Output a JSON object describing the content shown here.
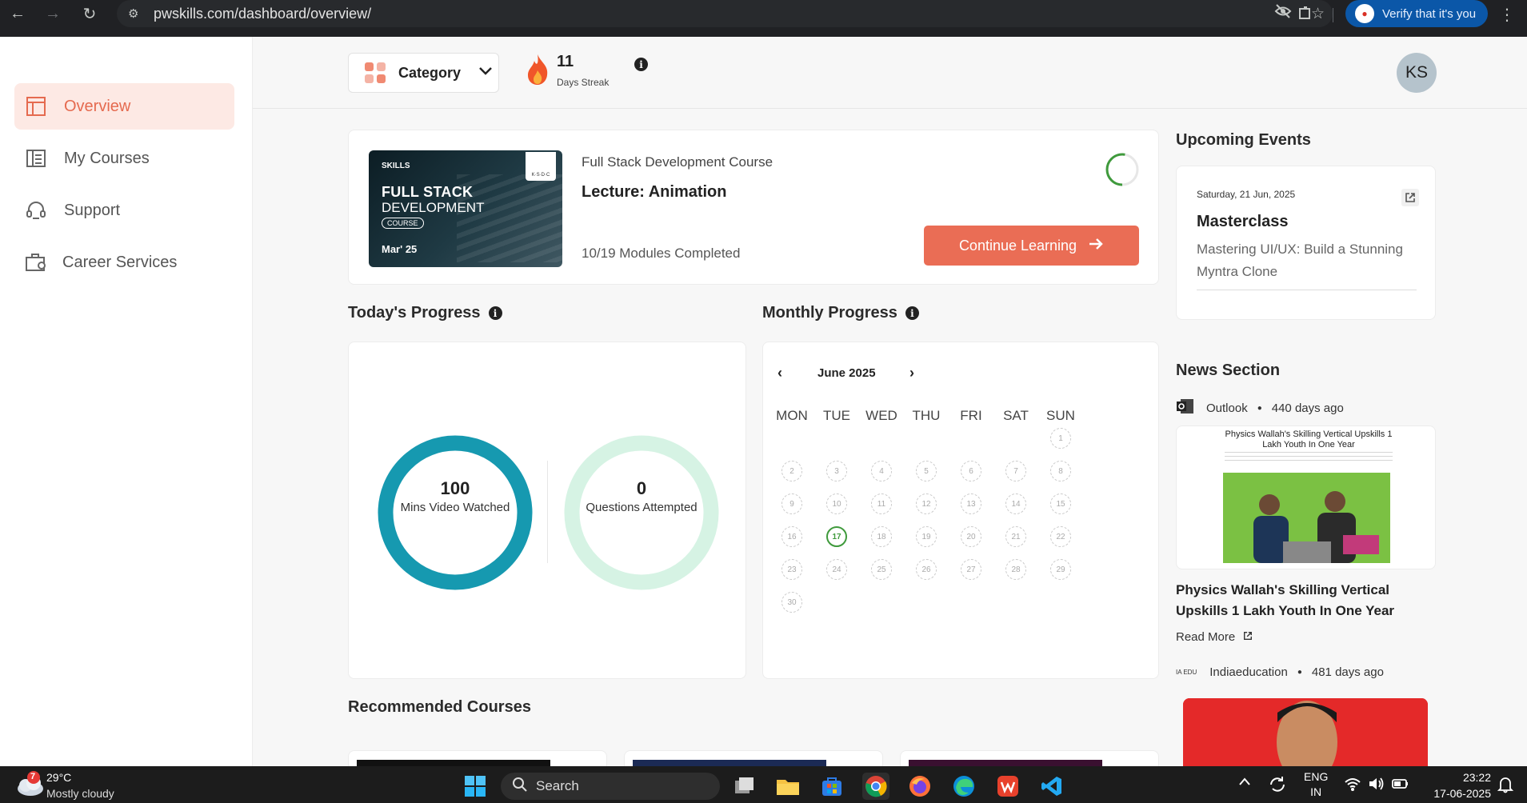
{
  "browser": {
    "url": "pwskills.com/dashboard/overview/",
    "verify_label": "Verify that it's you"
  },
  "sidebar": {
    "items": [
      {
        "label": "Overview",
        "icon": "layout-icon",
        "active": true
      },
      {
        "label": "My Courses",
        "icon": "courses-icon",
        "active": false
      },
      {
        "label": "Support",
        "icon": "headset-icon",
        "active": false
      },
      {
        "label": "Career Services",
        "icon": "briefcase-icon",
        "active": false
      }
    ]
  },
  "topbar": {
    "category_label": "Category",
    "streak_count": "11",
    "streak_label": "Days Streak",
    "avatar_initials": "KS"
  },
  "course": {
    "thumb_brand": "SKILLS",
    "thumb_line1": "FULL STACK",
    "thumb_line2": "DEVELOPMENT",
    "thumb_tag": "COURSE",
    "thumb_date": "Mar' 25",
    "thumb_badge": "K·S·D·C",
    "name": "Full Stack Development Course",
    "lecture": "Lecture: Animation",
    "modules": "10/19 Modules Completed",
    "continue_label": "Continue Learning"
  },
  "today": {
    "title": "Today's Progress",
    "video_value": "100",
    "video_label": "Mins Video Watched",
    "questions_value": "0",
    "questions_label": "Questions Attempted"
  },
  "monthly": {
    "title": "Monthly Progress",
    "month": "June 2025",
    "prev": "‹",
    "next": "›",
    "days_of_week": [
      "MON",
      "TUE",
      "WED",
      "THU",
      "FRI",
      "SAT",
      "SUN"
    ],
    "days": [
      "1",
      "2",
      "3",
      "4",
      "5",
      "6",
      "7",
      "8",
      "9",
      "10",
      "11",
      "12",
      "13",
      "14",
      "15",
      "16",
      "17",
      "18",
      "19",
      "20",
      "21",
      "22",
      "23",
      "24",
      "25",
      "26",
      "27",
      "28",
      "29",
      "30"
    ],
    "today": "17"
  },
  "events": {
    "title": "Upcoming Events",
    "date": "Saturday, 21 Jun, 2025",
    "name": "Masterclass",
    "description": "Mastering UI/UX: Build a Stunning Myntra Clone"
  },
  "news": {
    "title": "News Section",
    "items": [
      {
        "source": "Outlook",
        "age": "440 days ago",
        "image_headline": "Physics Wallah's Skilling Vertical Upskills 1 Lakh Youth In One Year",
        "headline": "Physics Wallah's Skilling Vertical Upskills 1 Lakh Youth In One Year",
        "read_more": "Read More"
      },
      {
        "source": "Indiaeducation",
        "age": "481 days ago",
        "source_logo": "IA EDU"
      }
    ]
  },
  "recommended": {
    "title": "Recommended Courses"
  },
  "taskbar": {
    "weather_badge": "7",
    "temperature": "29°C",
    "condition": "Mostly cloudy",
    "search_label": "Search",
    "lang_line1": "ENG",
    "lang_line2": "IN",
    "time": "23:22",
    "date": "17-06-2025"
  },
  "colors": {
    "accent": "#ea6d55",
    "active_bg": "#fde9e4",
    "video_ring": "#1699b0",
    "questions_ring": "#d6f3e4",
    "today_green": "#3f9a3c"
  }
}
